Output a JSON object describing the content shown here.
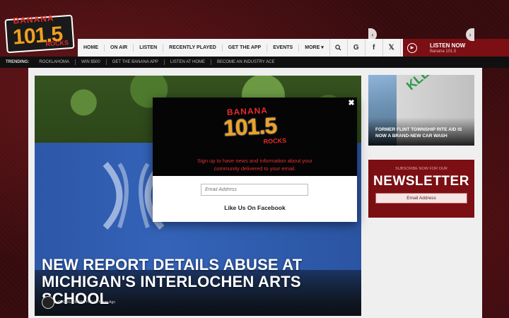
{
  "header": {
    "logo": {
      "line1": "BANANA",
      "line2": "101.5",
      "line3": "ROCKS"
    },
    "nav": [
      "HOME",
      "ON AIR",
      "LISTEN",
      "RECENTLY PLAYED",
      "GET THE APP",
      "EVENTS",
      "MORE"
    ],
    "icons": [
      "search-icon",
      "google-icon",
      "facebook-icon",
      "x-icon",
      "youtube-icon"
    ],
    "listen": {
      "title": "LISTEN NOW",
      "subtitle": "Banana 101.5"
    }
  },
  "trending": {
    "label": "TRENDING:",
    "items": [
      "ROCKLAHOMA",
      "WIN $500",
      "GET THE BANANA APP",
      "LISTEN AT HOME",
      "BECOME AN INDUSTRY ACE"
    ]
  },
  "hero": {
    "title_line1": "NEW REPORT DETAILS ABUSE AT",
    "title_line2": "MICHIGAN'S INTERLOCHEN ARTS SCHOOL",
    "author": "GEORGE MCINTYRE",
    "time": "9 Hours Ago"
  },
  "sidebar": {
    "card": {
      "sign": "KLEAN",
      "title_line1": "FORMER FLINT TOWNSHIP RITE AID IS",
      "title_line2": "NOW A BRAND-NEW CAR WASH"
    },
    "newsletter": {
      "sub": "SUBSCRIBE NOW FOR OUR",
      "title": "NEWSLETTER",
      "email_placeholder": "Email Address"
    }
  },
  "modal": {
    "close": "✖",
    "logo": {
      "line1": "BANANA",
      "line2": "101.5",
      "line3": "ROCKS"
    },
    "message_line1": "Sign up to have news and information about your",
    "message_line2": "community delivered to your email.",
    "email_placeholder": "Email Address",
    "facebook_label": "Like Us On Facebook"
  },
  "colors": {
    "brand_red": "#7b0f14",
    "logo_orange": "#f0a020",
    "accent_red": "#e53030"
  }
}
